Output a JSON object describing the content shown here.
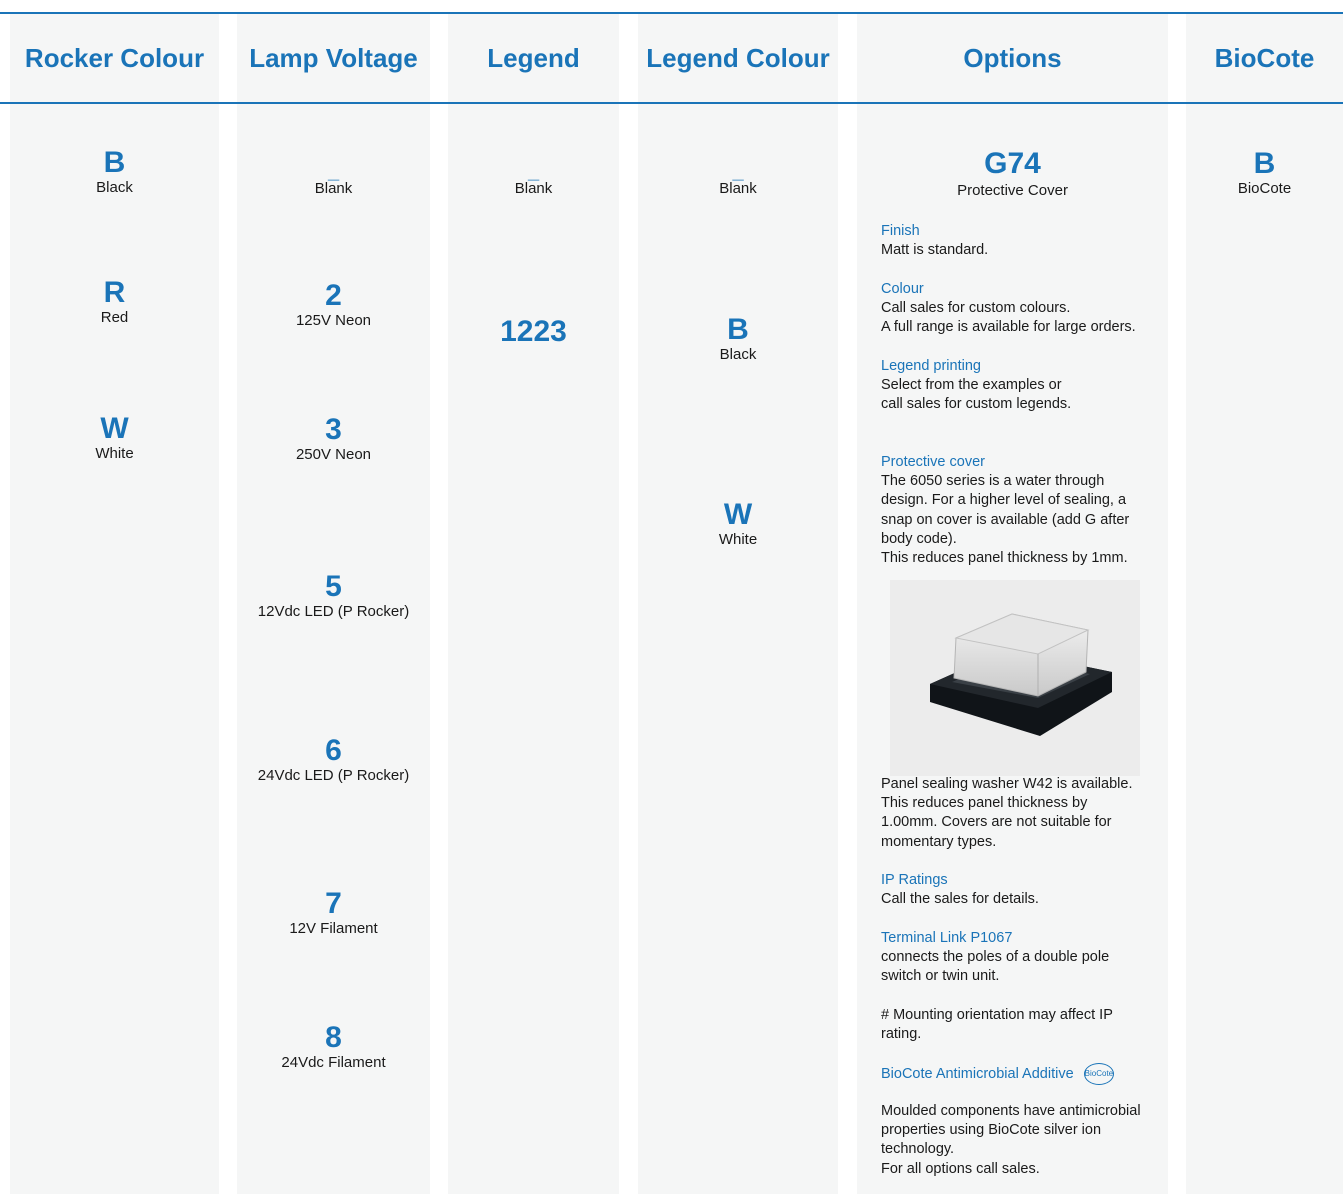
{
  "headers": {
    "rocker_colour": "Rocker Colour",
    "lamp_voltage": "Lamp Voltage",
    "legend": "Legend",
    "legend_colour": "Legend Colour",
    "options": "Options",
    "biocote": "BioCote"
  },
  "rocker_colour": [
    {
      "code": "B",
      "label": "Black"
    },
    {
      "code": "R",
      "label": "Red"
    },
    {
      "code": "W",
      "label": "White"
    }
  ],
  "lamp_voltage": [
    {
      "code": "_",
      "label": "Blank"
    },
    {
      "code": "2",
      "label": "125V Neon"
    },
    {
      "code": "3",
      "label": "250V Neon"
    },
    {
      "code": "5",
      "label": "12Vdc LED (P Rocker)"
    },
    {
      "code": "6",
      "label": "24Vdc LED (P Rocker)"
    },
    {
      "code": "7",
      "label": "12V Filament"
    },
    {
      "code": "8",
      "label": "24Vdc Filament"
    }
  ],
  "legend": [
    {
      "code": "_",
      "label": "Blank"
    },
    {
      "code": "1223",
      "label": ""
    }
  ],
  "legend_colour": [
    {
      "code": "_",
      "label": "Blank"
    },
    {
      "code": "B",
      "label": "Black"
    },
    {
      "code": "W",
      "label": "White"
    }
  ],
  "options": {
    "code": "G74",
    "code_label": "Protective Cover",
    "finish_title": "Finish",
    "finish_text": "Matt is standard.",
    "colour_title": "Colour",
    "colour_text_1": "Call sales for custom colours.",
    "colour_text_2": "A full range is available for large orders.",
    "legend_title": "Legend printing",
    "legend_text_1": "Select from the examples or",
    "legend_text_2": "call sales for custom legends.",
    "cover_title": "Protective cover",
    "cover_text_1": "The 6050 series is a water through",
    "cover_text_2": "design. For a higher level of sealing, a",
    "cover_text_3": "snap on cover is available (add G after",
    "cover_text_4": "body code).",
    "cover_text_5": "This reduces panel thickness by 1mm.",
    "washer_text_1": "Panel sealing washer W42 is available.",
    "washer_text_2": "This reduces panel thickness by",
    "washer_text_3": "1.00mm. Covers are not suitable for",
    "washer_text_4": "momentary types.",
    "ip_title": "IP Ratings",
    "ip_text": "Call the sales for details.",
    "terminal_title": "Terminal Link P1067",
    "terminal_text_1": "connects the poles of a double pole",
    "terminal_text_2": "switch or twin unit.",
    "mounting_text_1": "# Mounting orientation may affect IP",
    "mounting_text_2": "rating.",
    "biocote_title": "BioCote Antimicrobial Additive",
    "biocote_icon_text": "BioCote",
    "biocote_text_1": "Moulded components have antimicrobial",
    "biocote_text_2": "properties using BioCote silver ion",
    "biocote_text_3": "technology.",
    "biocote_text_4": "For all options call sales."
  },
  "biocote": [
    {
      "code": "B",
      "label": "BioCote"
    }
  ],
  "colors": {
    "accent": "#1a74b8",
    "column_bg": "#f5f6f6",
    "photo_bg": "#ececec"
  }
}
